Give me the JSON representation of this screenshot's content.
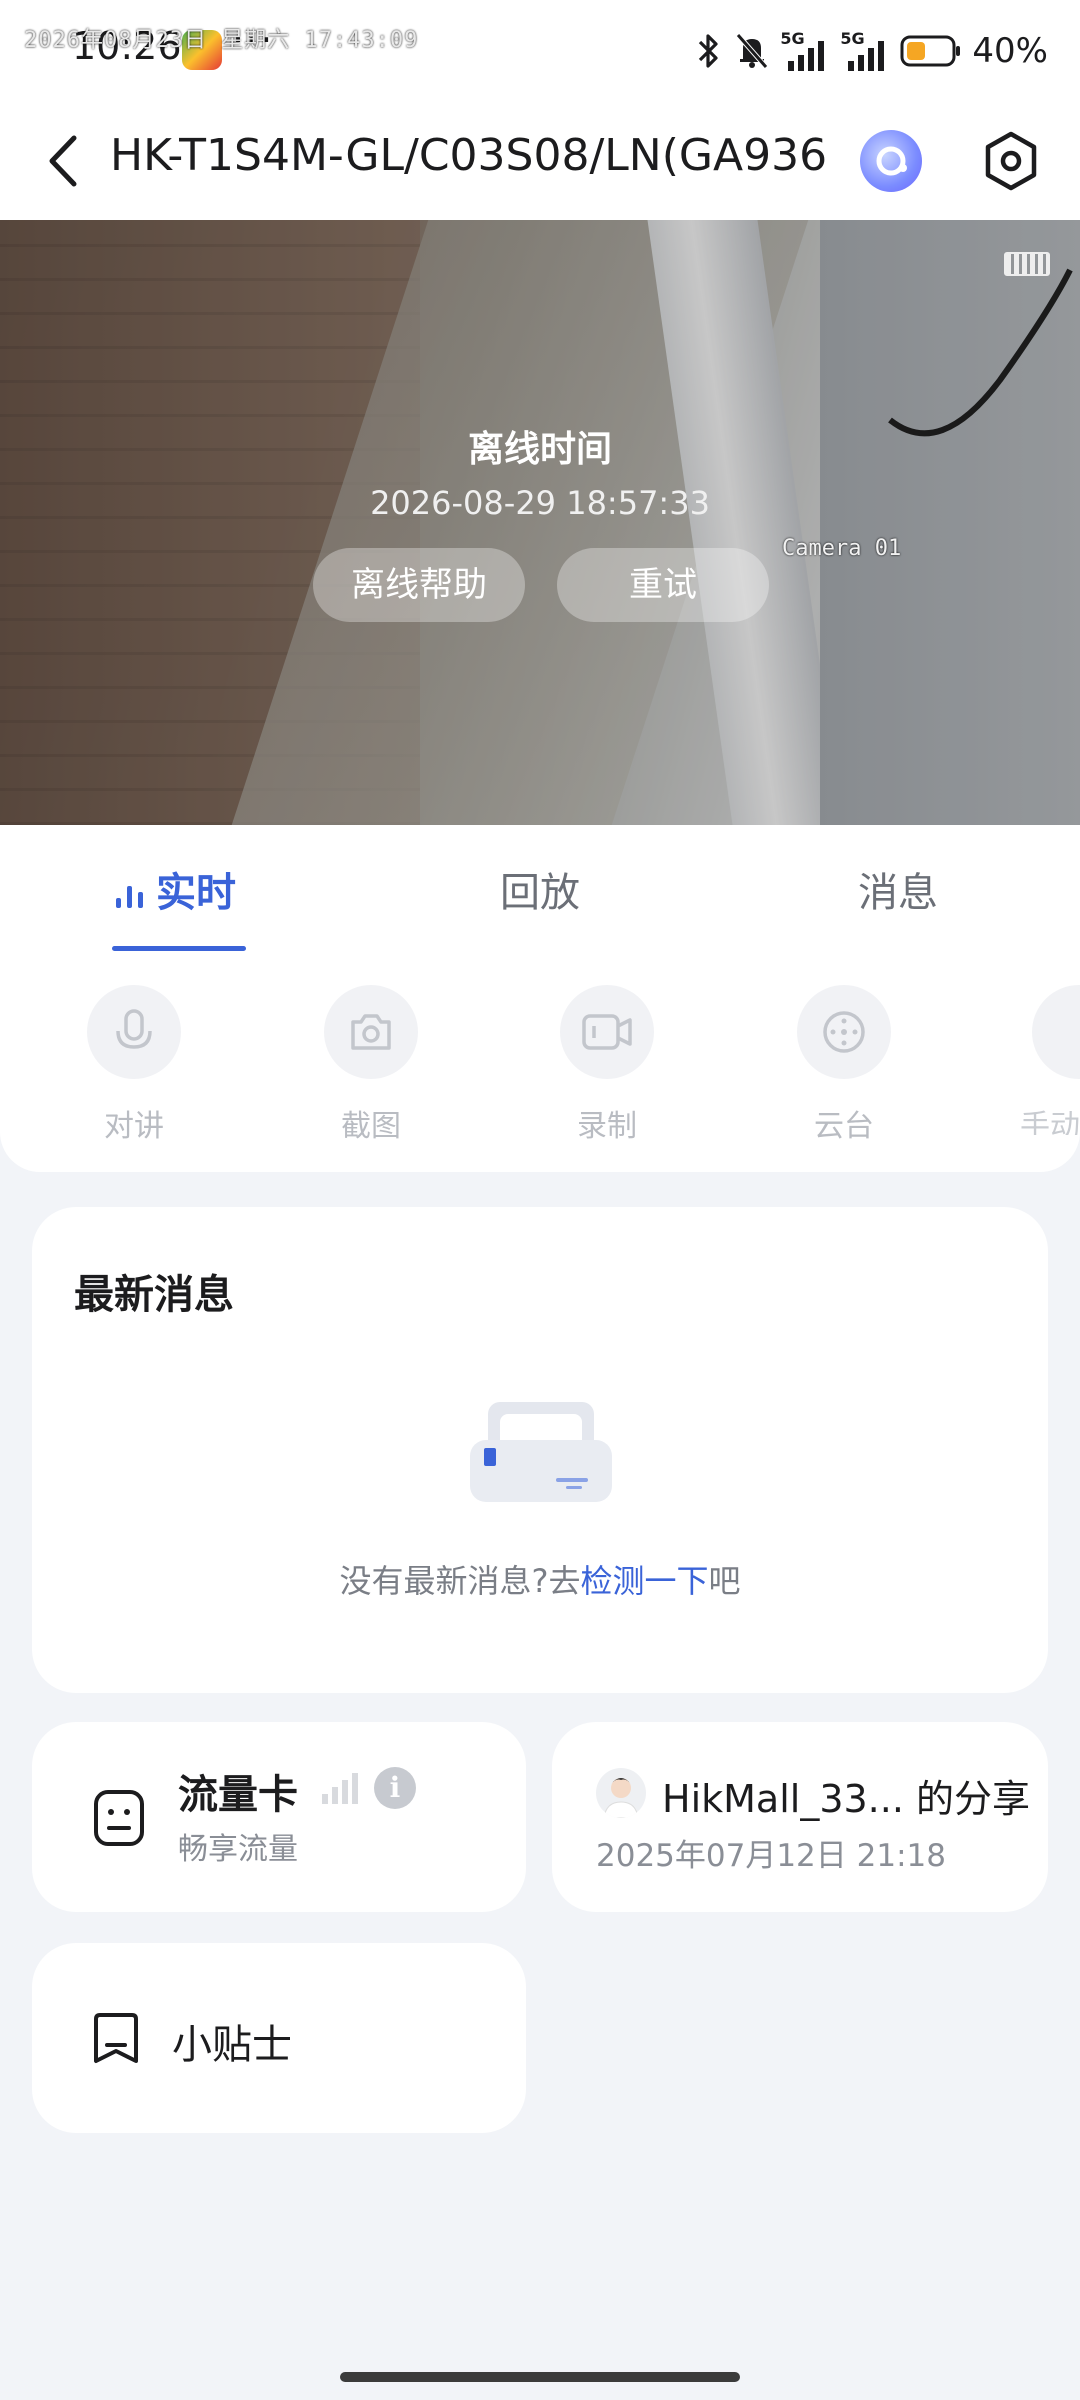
{
  "status_bar": {
    "time": "10:26",
    "dots": "···",
    "battery_text": "40%",
    "net1": "5G",
    "net2": "5G",
    "icons": [
      "bluetooth-icon",
      "mute-bell-icon",
      "signal-5g-icon",
      "signal-5g-icon",
      "battery-icon"
    ]
  },
  "header": {
    "title": "HK-T1S4M-GL/C03S08/LN(GA936..."
  },
  "video": {
    "osd_datetime": "2026年08月23日 星期六 17:43:09",
    "osd_camera": "Camera 01",
    "offline_label": "离线时间",
    "offline_time": "2026-08-29 18:57:33",
    "help_button": "离线帮助",
    "retry_button": "重试"
  },
  "tabs": [
    {
      "label": "实时",
      "active": true
    },
    {
      "label": "回放",
      "active": false
    },
    {
      "label": "消息",
      "active": false
    }
  ],
  "tools": [
    {
      "label": "对讲",
      "icon": "microphone-icon"
    },
    {
      "label": "截图",
      "icon": "camera-icon"
    },
    {
      "label": "录制",
      "icon": "video-record-icon"
    },
    {
      "label": "云台",
      "icon": "ptz-icon"
    },
    {
      "label": "手动",
      "icon": "manual-icon"
    }
  ],
  "news": {
    "title": "最新消息",
    "empty_prefix": "没有最新消息?去",
    "empty_link": "检测一下",
    "empty_suffix": "吧"
  },
  "flow_card": {
    "title": "流量卡",
    "subtitle": "畅享流量",
    "info": "i"
  },
  "share_card": {
    "title": "HikMall_33... 的分享",
    "time": "2025年07月12日 21:18"
  },
  "tips_card": {
    "title": "小贴士"
  },
  "colors": {
    "accent": "#3a63d8",
    "background": "#f2f4f8"
  }
}
